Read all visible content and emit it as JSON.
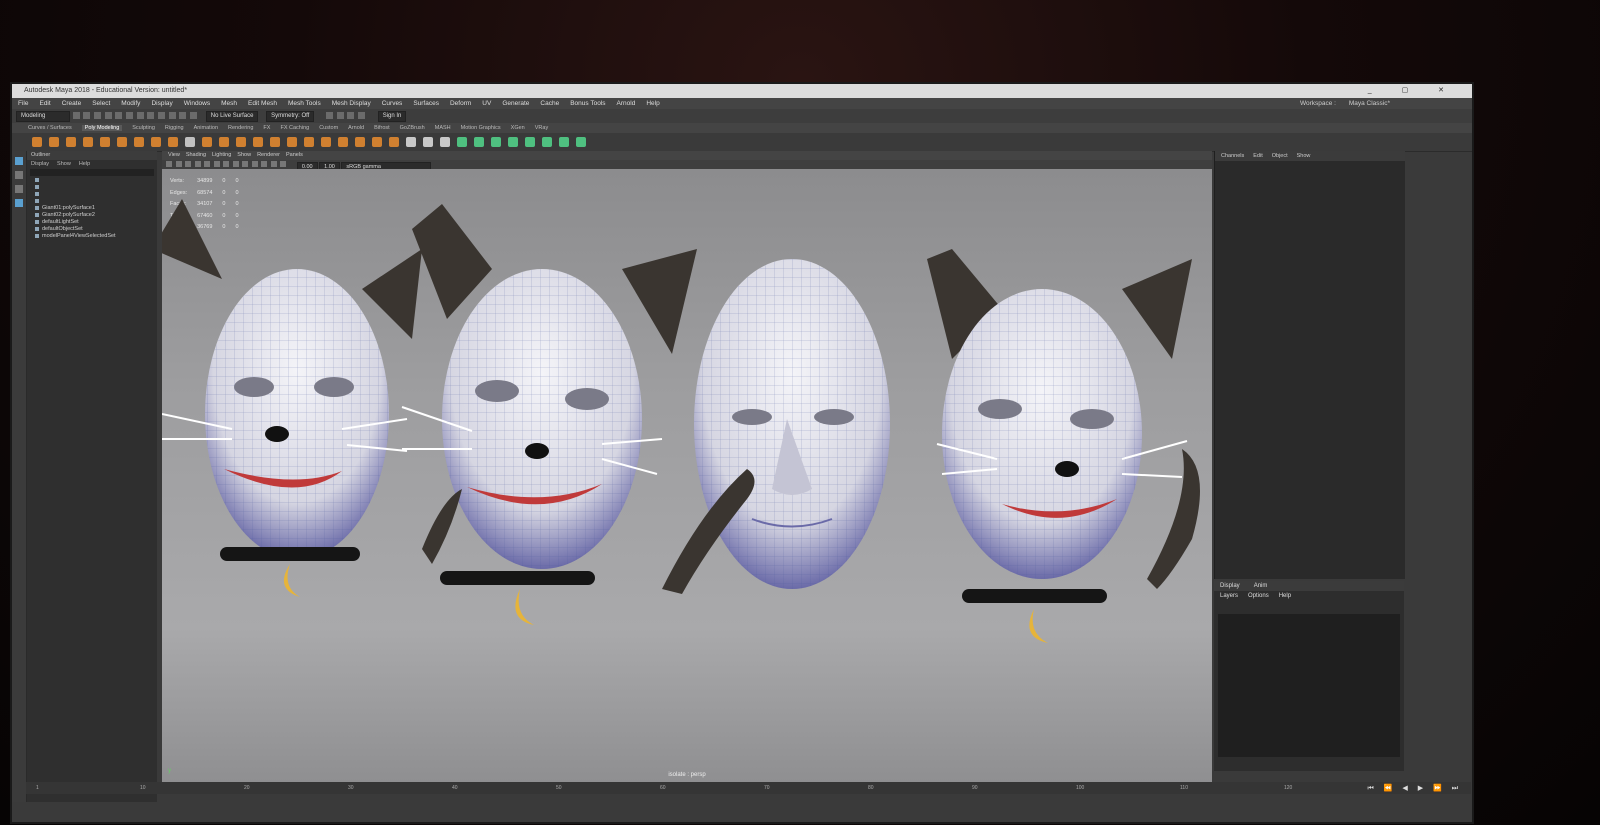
{
  "app": {
    "title": "Autodesk Maya 2018 - Educational Version: untitled*",
    "window_controls": "_ ▢ ✕"
  },
  "menubar": {
    "items": [
      "File",
      "Edit",
      "Create",
      "Select",
      "Modify",
      "Display",
      "Windows",
      "Mesh",
      "Edit Mesh",
      "Mesh Tools",
      "Mesh Display",
      "Curves",
      "Surfaces",
      "Deform",
      "UV",
      "Generate",
      "Cache",
      "Bonus Tools",
      "Arnold",
      "Help"
    ],
    "workspace_label": "Workspace :",
    "workspace_value": "Maya Classic*"
  },
  "statusline": {
    "mode": "Modeling",
    "live_surface": "No Live Surface",
    "symmetry": "Symmetry: Off",
    "sign_in": "Sign In"
  },
  "shelf": {
    "tabs": [
      "Curves / Surfaces",
      "Poly Modeling",
      "Sculpting",
      "Rigging",
      "Animation",
      "Rendering",
      "FX",
      "FX Caching",
      "Custom",
      "Arnold",
      "Bifrost",
      "GoZBrush",
      "MASH",
      "Motion Graphics",
      "XGen",
      "VRay"
    ],
    "active_tab": "Poly Modeling",
    "icon_colors": [
      "#d08030",
      "#d08030",
      "#d08030",
      "#d08030",
      "#d08030",
      "#d08030",
      "#d08030",
      "#d08030",
      "#d08030",
      "#c0c0c0",
      "#d08030",
      "#d08030",
      "#d08030",
      "#d08030",
      "#d08030",
      "#d08030",
      "#d08030",
      "#d08030",
      "#d08030",
      "#d08030",
      "#d08030",
      "#d08030",
      "#c8c8c8",
      "#c8c8c8",
      "#c8c8c8",
      "#4fc080",
      "#4fc080",
      "#4fc080",
      "#4fc080",
      "#4fc080",
      "#4fc080",
      "#4fc080",
      "#4fc080"
    ]
  },
  "outliner": {
    "title": "Outliner",
    "menu": [
      "Display",
      "Show",
      "Help"
    ],
    "items": [
      "Giant01:polySurface1",
      "Giant02:polySurface2",
      "defaultLightSet",
      "defaultObjectSet",
      "modelPanel4ViewSelectedSet"
    ]
  },
  "viewport": {
    "menu": [
      "View",
      "Shading",
      "Lighting",
      "Show",
      "Renderer",
      "Panels"
    ],
    "value_a": "0.00",
    "value_b": "1.00",
    "color_space": "sRGB gamma",
    "hud": [
      {
        "label": "Verts:",
        "v1": "34899",
        "v2": "0",
        "v3": "0"
      },
      {
        "label": "Edges:",
        "v1": "68574",
        "v2": "0",
        "v3": "0"
      },
      {
        "label": "Faces:",
        "v1": "34107",
        "v2": "0",
        "v3": "0"
      },
      {
        "label": "Tris:",
        "v1": "67460",
        "v2": "0",
        "v3": "0"
      },
      {
        "label": "UVs:",
        "v1": "36769",
        "v2": "0",
        "v3": "0"
      }
    ],
    "camera_label": "isolate : persp",
    "axis_label": "y"
  },
  "channelbox": {
    "menu": [
      "Channels",
      "Edit",
      "Object",
      "Show"
    ]
  },
  "layers": {
    "tabs": [
      "Display",
      "Anim"
    ],
    "menu": [
      "Layers",
      "Options",
      "Help"
    ]
  },
  "timeline": {
    "ticks": [
      "1",
      "10",
      "20",
      "30",
      "40",
      "50",
      "60",
      "70",
      "80",
      "90",
      "100",
      "110",
      "120"
    ],
    "transport": "⏮ ⏪ ◀ ▶ ⏩ ⏭"
  },
  "colors": {
    "face_skin": "#dcdce6",
    "fur": "#3a3530",
    "lips": "#c03a3a",
    "collar": "#151515",
    "pendant": "#e6b43a"
  }
}
